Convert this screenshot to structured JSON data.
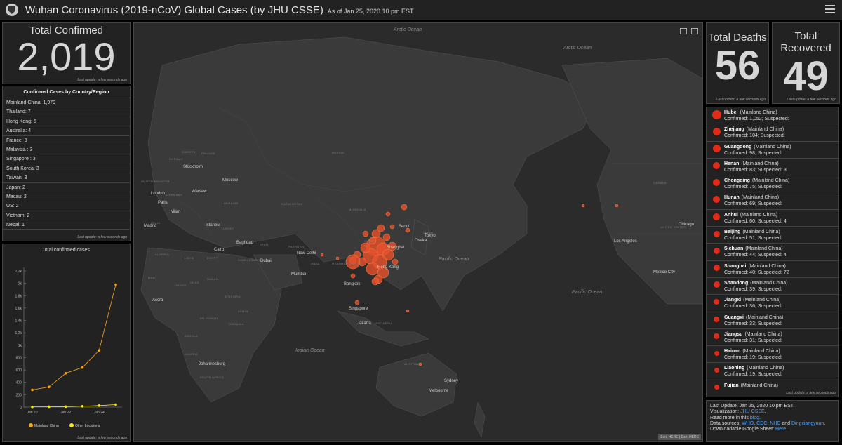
{
  "header": {
    "title": "Wuhan Coronavirus (2019-nCoV) Global Cases (by JHU CSSE)",
    "subtitle": "As of Jan 25, 2020 10 pm EST"
  },
  "total_confirmed": {
    "label": "Total Confirmed",
    "value": "2,019",
    "update": "Last update: a few seconds ago"
  },
  "country_list": {
    "title": "Confirmed Cases by Country/Region",
    "items": [
      "Mainland China:  1,979",
      "Thailand:  7",
      "Hong Kong:  5",
      "Australia:  4",
      "France:  3",
      "Malaysia :  3",
      "Singapore :  3",
      "South Korea:  3",
      "Taiwan:  3",
      "Japan:  2",
      "Macau:  2",
      "US:  2",
      "Vietnam:  2",
      "Nepal:  1"
    ],
    "update": "Last update: a few seconds ago"
  },
  "chart_panel": {
    "update": "Last update: a few seconds ago"
  },
  "chart_data": {
    "type": "line",
    "title": "Total confirmed cases",
    "x": [
      "Jan 20",
      "Jan 21",
      "Jan 22",
      "Jan 23",
      "Jan 24",
      "Jan 25"
    ],
    "xticks": [
      "Jan 20",
      "Jan 22",
      "Jan 24"
    ],
    "ylim": [
      0,
      2200
    ],
    "yticks": [
      "0",
      "200",
      "400",
      "600",
      "800",
      "1k",
      "1.2k",
      "1.4k",
      "1.6k",
      "1.8k",
      "2k",
      "2.2k"
    ],
    "series": [
      {
        "name": "Mainland China",
        "color": "#f5a623",
        "values": [
          278,
          326,
          547,
          639,
          916,
          1979
        ]
      },
      {
        "name": "Other Locations",
        "color": "#f8e71c",
        "values": [
          4,
          6,
          8,
          14,
          25,
          40
        ]
      }
    ]
  },
  "map": {
    "oceans": [
      "Arctic Ocean",
      "Arctic Ocean",
      "Pacific Ocean",
      "Pacific Ocean",
      "Indian Ocean"
    ],
    "cities": [
      "Stockholm",
      "London",
      "Warsaw",
      "Moscow",
      "Paris",
      "Milan",
      "Madrid",
      "Istanbul",
      "Cairo",
      "Baghdad",
      "Dubai",
      "New Delhi",
      "Mumbai",
      "Bangkok",
      "Singapore",
      "Jakarta",
      "Shanghai",
      "Hong Kong",
      "Osaka",
      "Tokyo",
      "Seoul",
      "Sydney",
      "Melbourne",
      "Johannesburg",
      "Accra",
      "Los Angeles",
      "Chicago",
      "Mexico City"
    ],
    "regions": [
      "SWEDEN",
      "FINLAND",
      "NORWAY",
      "RUSSIA",
      "KAZAKHSTAN",
      "MONGOLIA",
      "CHINA",
      "INDIA",
      "IRAN",
      "TURKEY",
      "EGYPT",
      "LIBYA",
      "ALGERIA",
      "NIGER",
      "CHAD",
      "SUDAN",
      "ETHIOPIA",
      "DR CONGO",
      "ANGOLA",
      "NAMIBIA",
      "SOUTH AFRICA",
      "SAUDI ARABIA",
      "PAKISTAN",
      "AUSTRALIA",
      "INDONESIA",
      "MYANMAR (BURMA)",
      "JAPAN",
      "UNITED STATES",
      "CANADA",
      "MALI",
      "TANZANIA",
      "UNITED KINGDOM",
      "GERMANY",
      "SPAIN",
      "UKRAINE",
      "KENYA"
    ],
    "attribution": "Esri, HERE | Esri, HERE"
  },
  "total_deaths": {
    "label": "Total Deaths",
    "value": "56",
    "update": "Last update: a few seconds ago"
  },
  "total_recovered": {
    "label": "Total Recovered",
    "value": "49",
    "update": "Last update: a few seconds ago"
  },
  "provinces": {
    "items": [
      {
        "name": "Hubei",
        "region": "(Mainland China)",
        "detail": "Confirmed: 1,052; Suspected:"
      },
      {
        "name": "Zhejiang",
        "region": "(Mainland China)",
        "detail": "Confirmed: 104; Suspected:"
      },
      {
        "name": "Guangdong",
        "region": "(Mainland China)",
        "detail": "Confirmed: 98; Suspected:"
      },
      {
        "name": "Henan",
        "region": "(Mainland China)",
        "detail": "Confirmed: 83; Suspected: 3"
      },
      {
        "name": "Chongqing",
        "region": "(Mainland China)",
        "detail": "Confirmed: 75; Suspected:"
      },
      {
        "name": "Hunan",
        "region": "(Mainland China)",
        "detail": "Confirmed: 69; Suspected:"
      },
      {
        "name": "Anhui",
        "region": "(Mainland China)",
        "detail": "Confirmed: 60; Suspected: 4"
      },
      {
        "name": "Beijing",
        "region": "(Mainland China)",
        "detail": "Confirmed: 51; Suspected:"
      },
      {
        "name": "Sichuan",
        "region": "(Mainland China)",
        "detail": "Confirmed: 44; Suspected: 4"
      },
      {
        "name": "Shanghai",
        "region": "(Mainland China)",
        "detail": "Confirmed: 40; Suspected: 72"
      },
      {
        "name": "Shandong",
        "region": "(Mainland China)",
        "detail": "Confirmed: 39; Suspected:"
      },
      {
        "name": "Jiangxi",
        "region": "(Mainland China)",
        "detail": "Confirmed: 36; Suspected:"
      },
      {
        "name": "Guangxi",
        "region": "(Mainland China)",
        "detail": "Confirmed: 33; Suspected:"
      },
      {
        "name": "Jiangsu",
        "region": "(Mainland China)",
        "detail": "Confirmed: 31; Suspected:"
      },
      {
        "name": "Hainan",
        "region": "(Mainland China)",
        "detail": "Confirmed: 19; Suspected:"
      },
      {
        "name": "Liaoning",
        "region": "(Mainland China)",
        "detail": "Confirmed: 19; Suspected:"
      },
      {
        "name": "Fujian",
        "region": "(Mainland China)",
        "detail": ""
      }
    ],
    "update": "Last update: a few seconds ago"
  },
  "info": {
    "line1": "Last Update: Jan 25, 2020 10 pm EST.",
    "vis_label": "Visualization:",
    "vis_link": "JHU CSSE",
    "blog_pre": "Read more in this",
    "blog_link": "blog",
    "sources_label": "Data sources:",
    "src1": "WHO",
    "src2": "CDC",
    "src3": "NHC",
    "src_and": "and",
    "src4": "Dingxiangyuan",
    "sheet_label": "Downloadable Google Sheet:",
    "sheet_link": "Here"
  }
}
